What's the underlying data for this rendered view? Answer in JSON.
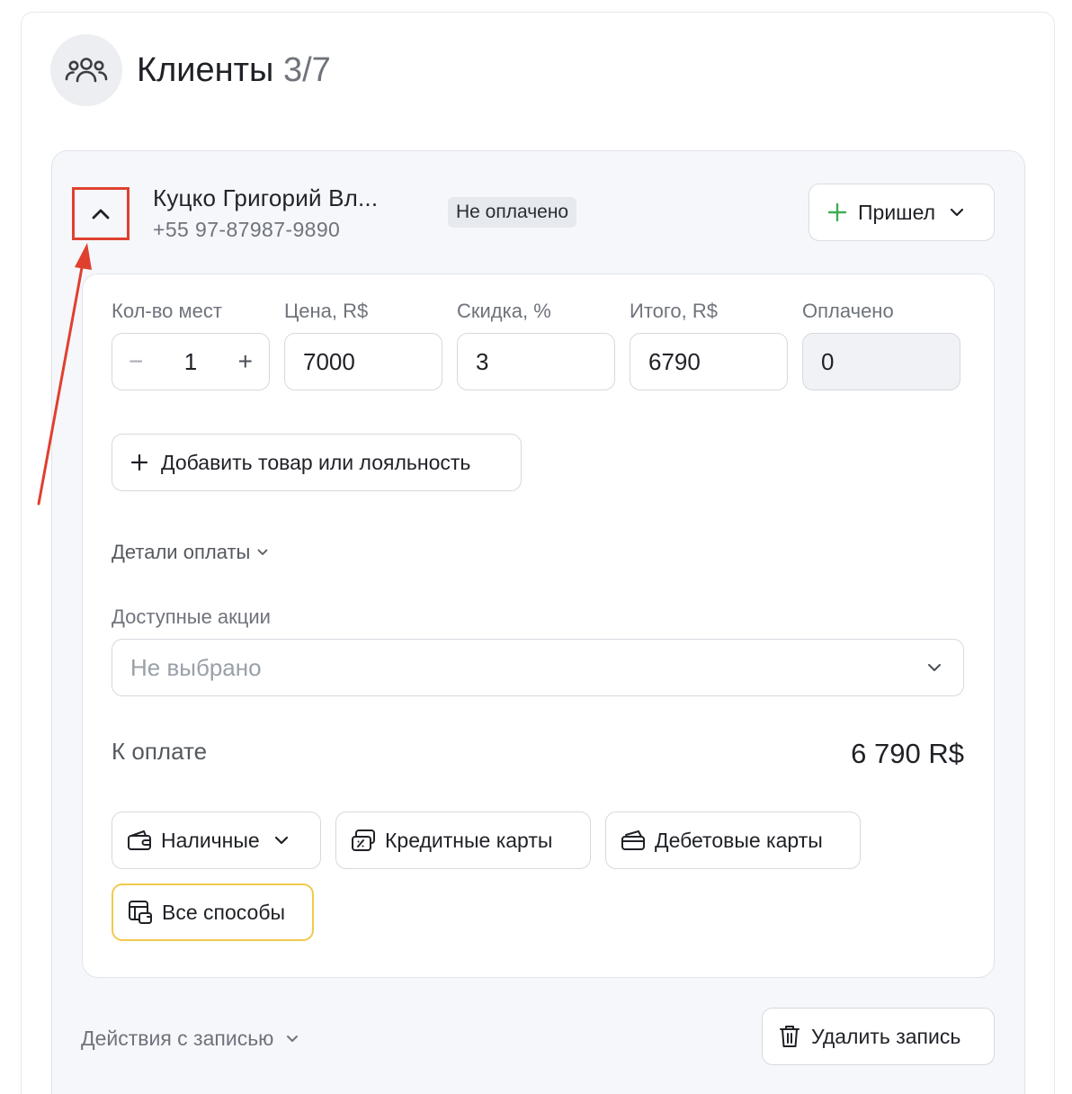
{
  "header": {
    "title": "Клиенты",
    "count": "3/7"
  },
  "client": {
    "name": "Куцко Григорий Вл...",
    "phone": "+55 97-87987-9890",
    "status": "Не оплачено",
    "came_label": "Пришел"
  },
  "fields": {
    "seats": {
      "label": "Кол-во мест",
      "value": "1",
      "minus": "−",
      "plus": "+"
    },
    "price": {
      "label": "Цена, R$",
      "value": "7000"
    },
    "discount": {
      "label": "Скидка, %",
      "value": "3"
    },
    "total": {
      "label": "Итого, R$",
      "value": "6790"
    },
    "paid": {
      "label": "Оплачено",
      "value": "0"
    }
  },
  "add_product_label": "Добавить товар или лояльность",
  "payment_details_label": "Детали оплаты",
  "promotions": {
    "label": "Доступные акции",
    "placeholder": "Не выбрано"
  },
  "to_pay": {
    "label": "К оплате",
    "amount": "6 790 R$"
  },
  "payment_methods": [
    {
      "label": "Наличные",
      "icon": "wallet-icon"
    },
    {
      "label": "Кредитные карты",
      "icon": "credit-card-icon"
    },
    {
      "label": "Дебетовые карты",
      "icon": "debit-card-icon"
    },
    {
      "label": "Все способы",
      "icon": "all-methods-icon"
    }
  ],
  "record_actions_label": "Действия с записью",
  "delete_label": "Удалить запись",
  "colors": {
    "annotation_red": "#e0402f",
    "plus_green": "#3fae52",
    "selected_border": "#f2c94c"
  }
}
